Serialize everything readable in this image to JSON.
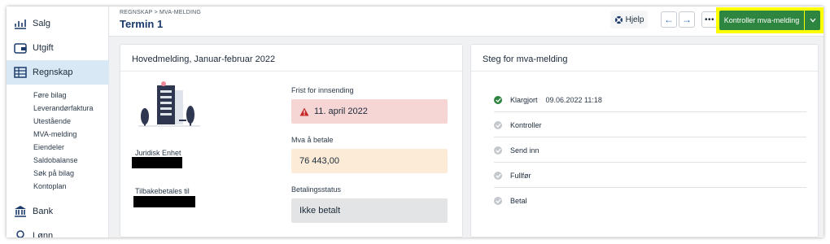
{
  "sidebar": {
    "items": [
      {
        "label": "Salg",
        "icon": "chart-icon"
      },
      {
        "label": "Utgift",
        "icon": "wallet-icon"
      },
      {
        "label": "Regnskap",
        "icon": "ledger-icon"
      },
      {
        "label": "Bank",
        "icon": "bank-icon"
      },
      {
        "label": "Lønn",
        "icon": "payroll-icon"
      }
    ],
    "sub_items": [
      "Føre bilag",
      "Leverandørfaktura",
      "Utestående",
      "MVA-melding",
      "Eiendeler",
      "Saldobalanse",
      "Søk på bilag",
      "Kontoplan"
    ]
  },
  "header": {
    "breadcrumb": "REGNSKAP > MVA-MELDING",
    "title": "Termin 1",
    "help_label": "Hjelp",
    "more_label": "•••",
    "primary_label": "Kontroller mva-melding"
  },
  "main_card": {
    "title": "Hovedmelding, Januar-februar 2022",
    "juridisk_label": "Juridisk Enhet",
    "tilbake_label": "Tilbakebetales til",
    "frist_label": "Frist for innsending",
    "frist_value": "11. april 2022",
    "mva_label": "Mva å betale",
    "mva_value": "76 443,00",
    "status_label": "Betalingsstatus",
    "status_value": "Ikke betalt"
  },
  "steps_card": {
    "title": "Steg for mva-melding",
    "steps": [
      {
        "label": "Klargjort",
        "timestamp": "09.06.2022 11:18",
        "done": true
      },
      {
        "label": "Kontroller",
        "timestamp": "",
        "done": false
      },
      {
        "label": "Send inn",
        "timestamp": "",
        "done": false
      },
      {
        "label": "Fullfør",
        "timestamp": "",
        "done": false
      },
      {
        "label": "Betal",
        "timestamp": "",
        "done": false
      }
    ]
  },
  "colors": {
    "primary": "#2e8540",
    "highlight": "#ffff00",
    "warning_bg": "#f6d5d5",
    "amount_bg": "#fcebd6",
    "status_bg": "#e3e4e5",
    "active_nav": "#d8e9f5",
    "link": "#2b6cb0"
  }
}
